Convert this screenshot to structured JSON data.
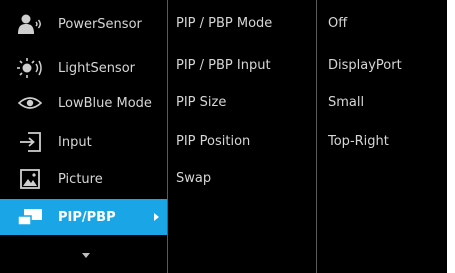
{
  "menu": {
    "items": [
      {
        "label": "PowerSensor",
        "icon": "power-sensor-icon"
      },
      {
        "label": "LightSensor",
        "icon": "light-sensor-icon"
      },
      {
        "label": "LowBlue Mode",
        "icon": "eye-icon"
      },
      {
        "label": "Input",
        "icon": "input-icon"
      },
      {
        "label": "Picture",
        "icon": "picture-icon"
      },
      {
        "label": "PIP/PBP",
        "icon": "pip-pbp-icon",
        "active": true
      }
    ],
    "more_indicator": "chevron-down-icon"
  },
  "submenu": {
    "items": [
      {
        "label": "PIP / PBP Mode"
      },
      {
        "label": "PIP / PBP Input"
      },
      {
        "label": "PIP Size"
      },
      {
        "label": "PIP Position"
      },
      {
        "label": "Swap"
      }
    ]
  },
  "values": {
    "items": [
      {
        "label": "Off"
      },
      {
        "label": "DisplayPort"
      },
      {
        "label": "Small"
      },
      {
        "label": "Top-Right"
      }
    ]
  },
  "colors": {
    "background": "#000000",
    "highlight": "#1aa6e6",
    "text": "#d6d6d6"
  }
}
